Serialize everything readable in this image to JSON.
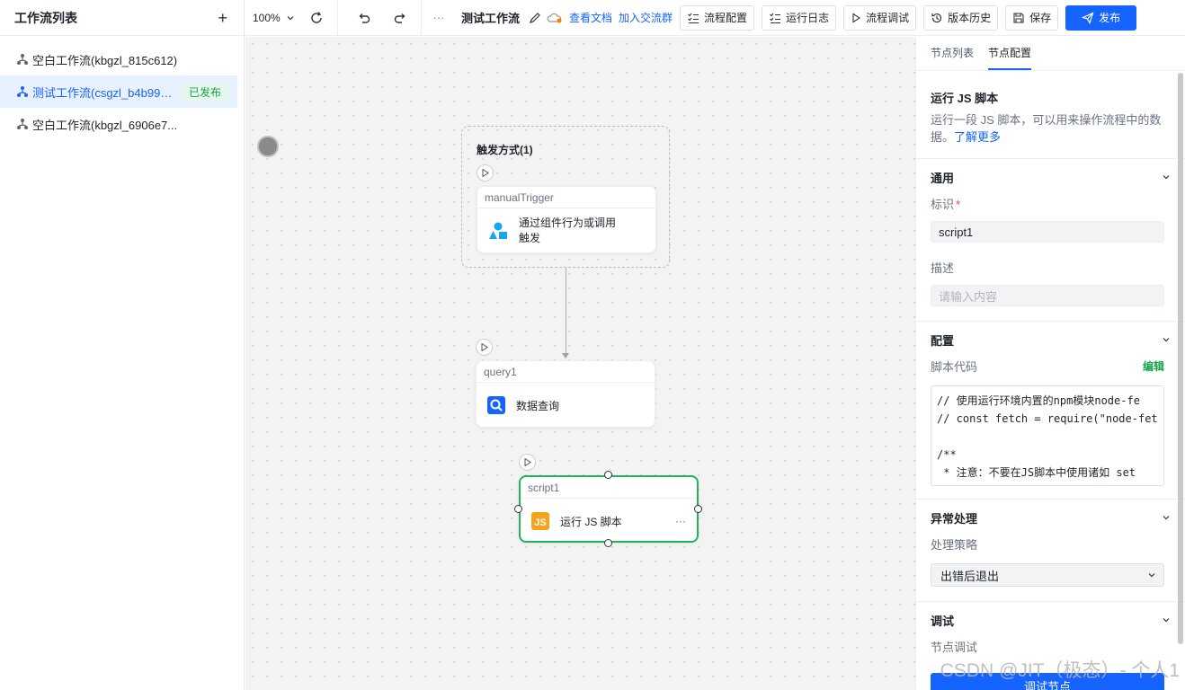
{
  "sidebar": {
    "title": "工作流列表",
    "add_icon": "plus-icon",
    "items": [
      {
        "name": "空白工作流(kbgzl_815c612)",
        "active": false,
        "badge": ""
      },
      {
        "name": "测试工作流(csgzl_b4b991c)",
        "active": true,
        "badge": "已发布"
      },
      {
        "name": "空白工作流(kbgzl_6906e7...",
        "active": false,
        "badge": ""
      }
    ]
  },
  "toolbar": {
    "zoom": "100%",
    "title": "测试工作流",
    "link_docs": "查看文档",
    "link_group": "加入交流群",
    "btn_config": "流程配置",
    "btn_log": "运行日志",
    "btn_debug": "流程调试",
    "btn_history": "版本历史",
    "btn_save": "保存",
    "btn_publish": "发布",
    "more": "···"
  },
  "canvas": {
    "trigger_group_label": "触发方式(1)",
    "nodes": [
      {
        "id": "manualTrigger",
        "label": "通过组件行为或调用\n触发"
      },
      {
        "id": "query1",
        "label": "数据查询"
      },
      {
        "id": "script1",
        "label": "运行 JS 脚本",
        "more": "···"
      }
    ]
  },
  "panel": {
    "tabs": [
      "节点列表",
      "节点配置"
    ],
    "active_tab": 1,
    "title": "运行 JS 脚本",
    "desc": "运行一段 JS 脚本，可以用来操作流程中的数据。",
    "learn_more": "了解更多",
    "general": {
      "head": "通用",
      "id_label": "标识",
      "id_value": "script1",
      "desc_label": "描述",
      "desc_placeholder": "请输入内容"
    },
    "config": {
      "head": "配置",
      "code_label": "脚本代码",
      "edit": "编辑",
      "code": "// 使用运行环境内置的npm模块node-fe\n// const fetch = require(\"node-fet\n\n/**\n * 注意：不要在JS脚本中使用诸如 set"
    },
    "error": {
      "head": "异常处理",
      "strategy_label": "处理策略",
      "strategy_value": "出错后退出"
    },
    "debug": {
      "head": "调试",
      "node_debug_label": "节点调试",
      "run_button": "调试节点"
    }
  },
  "watermark": "CSDN @JIT（极态）- 个人1",
  "colors": {
    "primary": "#1664ff",
    "success": "#22b35e",
    "badge_bg": "#e6f7ee"
  }
}
